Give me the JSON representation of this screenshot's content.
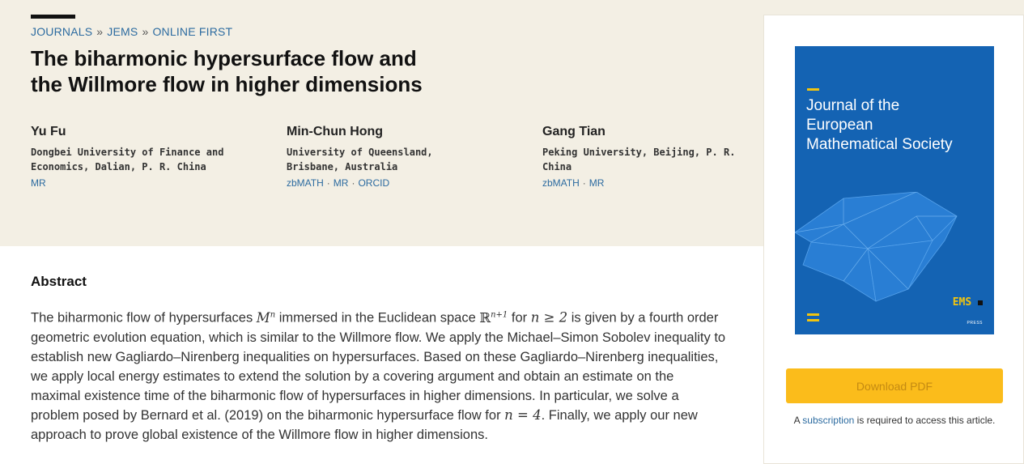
{
  "breadcrumb": [
    "JOURNALS",
    "JEMS",
    "ONLINE FIRST"
  ],
  "breadcrumb_separator": "»",
  "title_lines": [
    "The biharmonic hypersurface flow and",
    "the Willmore flow in higher dimensions"
  ],
  "authors": [
    {
      "name": "Yu Fu",
      "aff_lines": [
        "Dongbei University of Finance and",
        "Economics, Dalian, P. R. China"
      ],
      "links": [
        "MR"
      ]
    },
    {
      "name": "Min-Chun Hong",
      "aff_lines": [
        "University of Queensland,",
        "Brisbane, Australia"
      ],
      "links": [
        "zbMATH",
        "MR",
        "ORCID"
      ]
    },
    {
      "name": "Gang Tian",
      "aff_lines": [
        "Peking University, Beijing, P. R.",
        "China"
      ],
      "links": [
        "zbMATH",
        "MR"
      ]
    }
  ],
  "link_separator": "·",
  "abstract": {
    "heading": "Abstract",
    "p1": "The biharmonic flow of hypersurfaces ",
    "m1": "M",
    "m1_sup": "n",
    "p2": " immersed in the Euclidean space ",
    "m2": "ℝ",
    "m2_sup": "n+1",
    "p3": " for ",
    "m3": "n ≥ 2",
    "p4": " is given by a fourth order geometric evolution equation, which is similar to the Willmore flow. We apply the Michael–Simon Sobolev inequality to establish new Gagliardo–Nirenberg inequalities on hypersurfaces. Based on these Gagliardo–Nirenberg inequalities, we apply local energy estimates to extend the solution by a covering argument and obtain an estimate on the maximal existence time of the biharmonic flow of hypersurfaces in higher dimensions. In particular, we solve a problem posed by Bernard et al. (2019) on the biharmonic hypersurface flow for ",
    "m4": "n = 4",
    "p5": ". Finally, we apply our new approach to prove global existence of the Willmore flow in higher dimensions."
  },
  "cover": {
    "journal_name": "Journal of the European Mathematical Society",
    "publisher_mark": "EMS",
    "publisher_press": "PRESS",
    "background": "#1463b3",
    "accent": "#f1c40f"
  },
  "sidebar": {
    "download_label": "Download PDF",
    "note_prefix": "A ",
    "note_link": "subscription",
    "note_suffix": " is required to access this article."
  },
  "colors": {
    "hero_bg": "#f3efe4",
    "link": "#2c6ba0",
    "button": "#fbbc1b"
  }
}
